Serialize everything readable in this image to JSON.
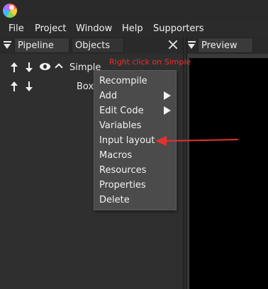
{
  "app": {
    "logo_icon": "app-logo-icon"
  },
  "menu": [
    "File",
    "Project",
    "Window",
    "Help",
    "Supporters"
  ],
  "tabs": {
    "pipeline": "Pipeline",
    "objects": "Objects",
    "preview": "Preview"
  },
  "pipeline": {
    "items": [
      {
        "label": "Simple"
      },
      {
        "label": "Box"
      }
    ]
  },
  "hint": "Right click on Simple",
  "context_menu": {
    "items": [
      {
        "label": "Recompile",
        "submenu": false
      },
      {
        "label": "Add",
        "submenu": true
      },
      {
        "label": "Edit Code",
        "submenu": true
      },
      {
        "label": "Variables",
        "submenu": false
      },
      {
        "label": "Input layout",
        "submenu": false
      },
      {
        "label": "Macros",
        "submenu": false
      },
      {
        "label": "Resources",
        "submenu": false
      },
      {
        "label": "Properties",
        "submenu": false
      },
      {
        "label": "Delete",
        "submenu": false
      }
    ]
  },
  "colors": {
    "annotation": "#e53030",
    "preview_bg": "#000000",
    "menu_bg": "#4b4b4b"
  }
}
